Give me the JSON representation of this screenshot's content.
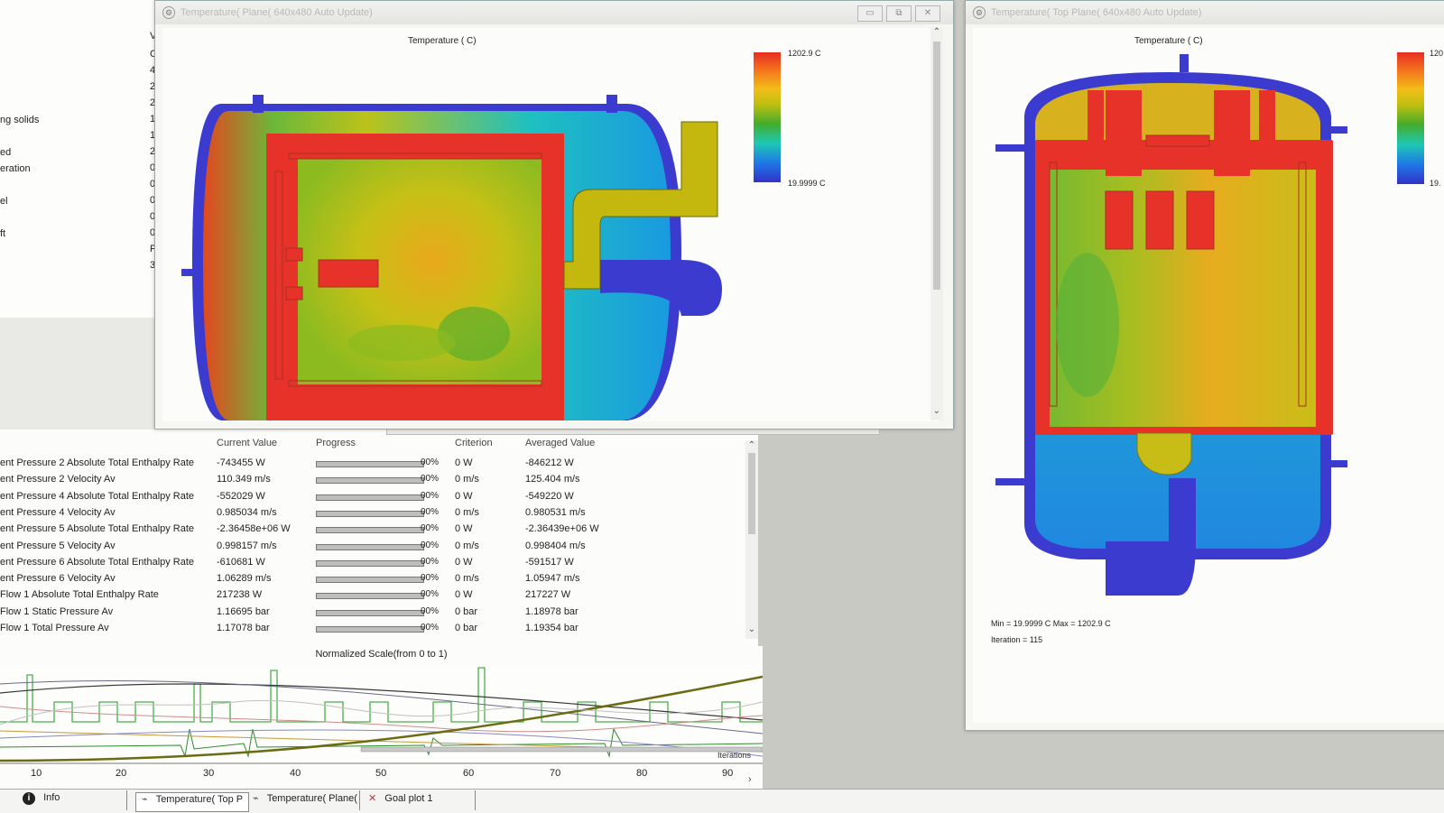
{
  "param_list": {
    "labels": [
      "ng solids",
      "ed",
      "eration",
      "el",
      "ft"
    ],
    "values": [
      "V",
      "C",
      "4",
      "2",
      "2",
      "1",
      "1",
      "2",
      "0",
      "0",
      "0",
      "0",
      "0",
      "P",
      "3"
    ]
  },
  "front_window": {
    "title": "Temperature( Plane( 640x480 Auto Update)",
    "plot_title": "Temperature ( C)",
    "legend_max": "1202.9 C",
    "legend_min": "19.9999 C",
    "buttons": [
      "▭",
      "⧉",
      "✕"
    ]
  },
  "side_window": {
    "title": "Temperature( Top Plane( 640x480 Auto Update)",
    "plot_title": "Temperature ( C)",
    "legend_max": "120",
    "legend_min": "19.",
    "minmax": "Min = 19.9999  C   Max = 1202.9  C",
    "iteration": "Iteration = 115"
  },
  "goals": {
    "headers": {
      "current": "Current Value",
      "progress": "Progress",
      "criterion": "Criterion",
      "averaged": "Averaged Value"
    },
    "rows": [
      {
        "name": "ent Pressure 2 Absolute Total Enthalpy Rate",
        "current": "-743455 W",
        "progress": 1.0,
        "pct": "00%",
        "criterion": "0 W",
        "averaged": "-846212 W"
      },
      {
        "name": "ent Pressure 2 Velocity Av",
        "current": "110.349 m/s",
        "progress": 1.0,
        "pct": "00%",
        "criterion": "0 m/s",
        "averaged": "125.404 m/s"
      },
      {
        "name": "ent Pressure 4 Absolute Total Enthalpy Rate",
        "current": "-552029 W",
        "progress": 1.0,
        "pct": "00%",
        "criterion": "0 W",
        "averaged": "-549220 W"
      },
      {
        "name": "ent Pressure 4 Velocity Av",
        "current": "0.985034 m/s",
        "progress": 1.0,
        "pct": "00%",
        "criterion": "0 m/s",
        "averaged": "0.980531 m/s"
      },
      {
        "name": "ent Pressure 5 Absolute Total Enthalpy Rate",
        "current": "-2.36458e+06 W",
        "progress": 1.0,
        "pct": "00%",
        "criterion": "0 W",
        "averaged": "-2.36439e+06 W"
      },
      {
        "name": "ent Pressure 5 Velocity Av",
        "current": "0.998157 m/s",
        "progress": 1.0,
        "pct": "00%",
        "criterion": "0 m/s",
        "averaged": "0.998404 m/s"
      },
      {
        "name": "ent Pressure 6 Absolute Total Enthalpy Rate",
        "current": "-610681 W",
        "progress": 1.0,
        "pct": "00%",
        "criterion": "0 W",
        "averaged": "-591517 W"
      },
      {
        "name": "ent Pressure 6 Velocity Av",
        "current": "1.06289 m/s",
        "progress": 1.0,
        "pct": "00%",
        "criterion": "0 m/s",
        "averaged": "1.05947 m/s"
      },
      {
        "name": "Flow 1 Absolute Total Enthalpy Rate",
        "current": "217238 W",
        "progress": 1.0,
        "pct": "00%",
        "criterion": "0 W",
        "averaged": "217227 W"
      },
      {
        "name": "Flow 1 Static Pressure Av",
        "current": "1.16695 bar",
        "progress": 1.0,
        "pct": "00%",
        "criterion": "0 bar",
        "averaged": "1.18978 bar"
      },
      {
        "name": "Flow 1 Total Pressure Av",
        "current": "1.17078 bar",
        "progress": 1.0,
        "pct": "00%",
        "criterion": "0 bar",
        "averaged": "1.19354 bar"
      }
    ]
  },
  "goal_plot": {
    "scale_label": "Normalized Scale(from 0 to 1)",
    "x_axis_label": "Iterations",
    "x_ticks": [
      "10",
      "20",
      "30",
      "40",
      "50",
      "60",
      "70",
      "80",
      "90"
    ]
  },
  "tabs": [
    {
      "label": "Info",
      "icon": "info-icon"
    },
    {
      "label": "Temperature( Top P",
      "icon": "plot-icon"
    },
    {
      "label": "Temperature( Plane(",
      "icon": "plot-icon"
    },
    {
      "label": "Goal plot 1",
      "icon": "goal-plot-icon"
    }
  ]
}
